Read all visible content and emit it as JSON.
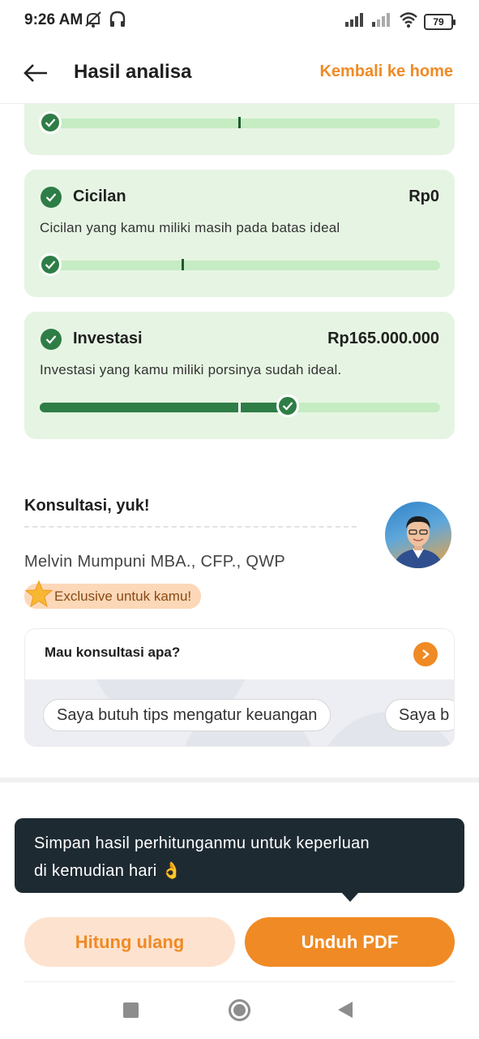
{
  "status_bar": {
    "time": "9:26 AM",
    "battery": "79"
  },
  "header": {
    "title": "Hasil analisa",
    "home_link": "Kembali ke home"
  },
  "cards": [
    {
      "title": "Cicilan",
      "amount": "Rp0",
      "description": "Cicilan yang kamu miliki masih pada batas ideal"
    },
    {
      "title": "Investasi",
      "amount": "Rp165.000.000",
      "description": "Investasi yang kamu miliki porsinya sudah ideal.",
      "progress_fraction": 0.62
    }
  ],
  "consult": {
    "title": "Konsultasi, yuk!",
    "advisor_name": "Melvin Mumpuni MBA., CFP., QWP",
    "badge": "Exclusive untuk kamu!",
    "question": "Mau konsultasi apa?",
    "chips": [
      "Saya butuh tips mengatur keuangan",
      "Saya b"
    ]
  },
  "tooltip": {
    "text_line1": "Simpan hasil perhitunganmu untuk keperluan",
    "text_line2": "di kemudian hari 👌"
  },
  "buttons": {
    "secondary": "Hitung ulang",
    "primary": "Unduh PDF"
  },
  "colors": {
    "accent": "#f08a24",
    "success": "#2e7d46",
    "card_bg": "#e6f5e3",
    "tooltip_bg": "#1e2a32"
  }
}
